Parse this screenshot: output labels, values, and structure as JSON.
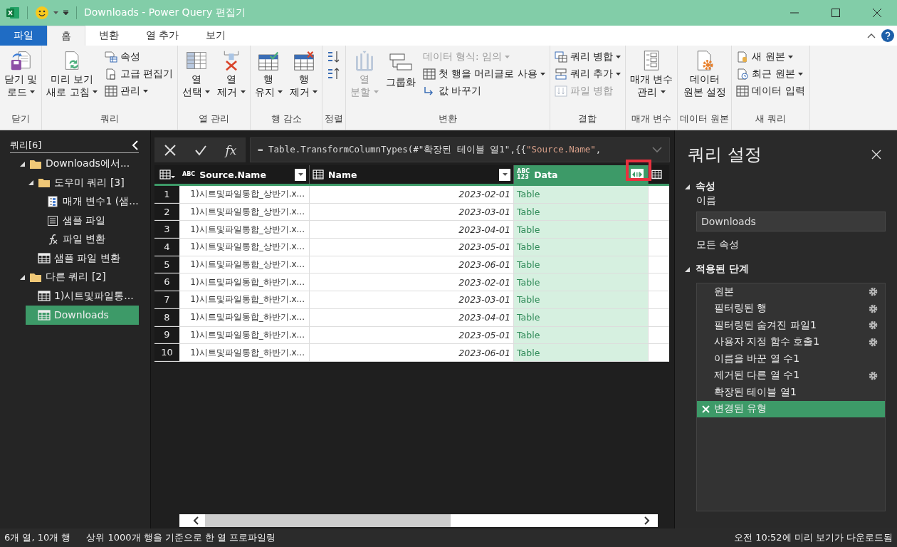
{
  "window": {
    "title": "Downloads - Power Query 편집기"
  },
  "ribbon_tabs": [
    {
      "label": "파일",
      "kind": "file",
      "selected": false
    },
    {
      "label": "홈",
      "kind": "tab",
      "selected": true
    },
    {
      "label": "변환",
      "kind": "tab",
      "selected": false
    },
    {
      "label": "열 추가",
      "kind": "tab",
      "selected": false
    },
    {
      "label": "보기",
      "kind": "tab",
      "selected": false
    }
  ],
  "ribbon_groups": [
    {
      "label": "닫기",
      "items": [
        {
          "kind": "large",
          "lines": [
            "닫기 및",
            "로드"
          ],
          "dropdown": true,
          "disabled": false
        }
      ]
    },
    {
      "label": "쿼리",
      "items": [
        {
          "kind": "large",
          "lines": [
            "미리 보기",
            "새로 고침"
          ],
          "dropdown": true,
          "disabled": false
        },
        {
          "kind": "small",
          "label": "속성",
          "dropdown": false,
          "disabled": false
        },
        {
          "kind": "small",
          "label": "고급 편집기",
          "dropdown": false,
          "disabled": false
        },
        {
          "kind": "small",
          "label": "관리",
          "dropdown": true,
          "disabled": false
        }
      ]
    },
    {
      "label": "열 관리",
      "items": [
        {
          "kind": "large",
          "lines": [
            "열",
            "선택"
          ],
          "dropdown": true,
          "disabled": false
        },
        {
          "kind": "large",
          "lines": [
            "열",
            "제거"
          ],
          "dropdown": true,
          "disabled": false
        }
      ]
    },
    {
      "label": "행 감소",
      "items": [
        {
          "kind": "large",
          "lines": [
            "행",
            "유지"
          ],
          "dropdown": true,
          "disabled": false
        },
        {
          "kind": "large",
          "lines": [
            "행",
            "제거"
          ],
          "dropdown": true,
          "disabled": false
        }
      ]
    },
    {
      "label": "정렬",
      "items": [
        {
          "kind": "icon"
        },
        {
          "kind": "icon"
        }
      ]
    },
    {
      "label": "변환",
      "items": [
        {
          "kind": "large",
          "lines": [
            "열",
            "분할"
          ],
          "dropdown": true,
          "disabled": true
        },
        {
          "kind": "large",
          "lines": [
            "그룹화"
          ],
          "dropdown": false,
          "disabled": false
        },
        {
          "kind": "small",
          "label": "데이터 형식: 임의",
          "dropdown": true,
          "disabled": true
        },
        {
          "kind": "small",
          "label": "첫 행을 머리글로 사용",
          "dropdown": true,
          "disabled": false
        },
        {
          "kind": "small",
          "label": "값 바꾸기",
          "dropdown": false,
          "disabled": false
        }
      ]
    },
    {
      "label": "결합",
      "items": [
        {
          "kind": "small",
          "label": "쿼리 병합",
          "dropdown": true,
          "disabled": false
        },
        {
          "kind": "small",
          "label": "쿼리 추가",
          "dropdown": true,
          "disabled": false
        },
        {
          "kind": "small",
          "label": "파일 병합",
          "dropdown": false,
          "disabled": true
        }
      ]
    },
    {
      "label": "매개 변수",
      "items": [
        {
          "kind": "large",
          "lines": [
            "매개 변수",
            "관리"
          ],
          "dropdown": true,
          "disabled": false
        }
      ]
    },
    {
      "label": "데이터 원본",
      "items": [
        {
          "kind": "large",
          "lines": [
            "데이터",
            "원본 설정"
          ],
          "dropdown": false,
          "disabled": false
        }
      ]
    },
    {
      "label": "새 쿼리",
      "items": [
        {
          "kind": "small",
          "label": "새 원본",
          "dropdown": true,
          "disabled": false
        },
        {
          "kind": "small",
          "label": "최근 원본",
          "dropdown": true,
          "disabled": false
        },
        {
          "kind": "small",
          "label": "데이터 입력",
          "dropdown": false,
          "disabled": false
        }
      ]
    }
  ],
  "queries_pane": {
    "title": "쿼리[6]",
    "items": [
      {
        "label": "Downloads에서...",
        "kind": "folder",
        "expanded": true,
        "selected": false,
        "children": [
          {
            "label": "도우미 쿼리 [3]",
            "kind": "folder",
            "expanded": true,
            "selected": false,
            "children": [
              {
                "label": "매개 변수1 (샘...",
                "kind": "parameter",
                "selected": false
              },
              {
                "label": "샘플 파일",
                "kind": "file",
                "selected": false
              },
              {
                "label": "파일 변환",
                "kind": "function",
                "selected": false
              }
            ]
          },
          {
            "label": "샘플 파일 변환",
            "kind": "table",
            "selected": false
          }
        ]
      },
      {
        "label": "다른 쿼리 [2]",
        "kind": "folder",
        "expanded": true,
        "selected": false,
        "children": [
          {
            "label": "1)시트및파일통...",
            "kind": "table",
            "selected": false
          },
          {
            "label": "Downloads",
            "kind": "table",
            "selected": true
          }
        ]
      }
    ]
  },
  "formula_bar": {
    "function_label": "fx",
    "segments": [
      {
        "text": "= Table.TransformColumnTypes(#\"확장된 테이블 열1\",{{",
        "kind": "code"
      },
      {
        "text": "\"Source.Name\"",
        "kind": "string"
      },
      {
        "text": ",",
        "kind": "code"
      }
    ]
  },
  "table": {
    "columns": [
      {
        "kind": "text",
        "type_label": "ABC",
        "name": "Source.Name",
        "filter": true,
        "selected": false,
        "expandable": false,
        "highlighted": false
      },
      {
        "kind": "table",
        "name": "Name",
        "filter": true,
        "selected": false,
        "expandable": false,
        "highlighted": false
      },
      {
        "kind": "any",
        "type_lines": [
          "ABC",
          "123"
        ],
        "name": "Data",
        "filter": false,
        "selected": true,
        "expandable": true,
        "highlighted": true
      },
      {
        "kind": "table",
        "filter": false,
        "selected": false,
        "expandable": false,
        "highlighted": false
      }
    ],
    "rows": [
      {
        "number": "1",
        "cells": [
          "1)시트및파일통합_상반기.x...",
          "2023-02-01",
          "Table"
        ]
      },
      {
        "number": "2",
        "cells": [
          "1)시트및파일통합_상반기.x...",
          "2023-03-01",
          "Table"
        ]
      },
      {
        "number": "3",
        "cells": [
          "1)시트및파일통합_상반기.x...",
          "2023-04-01",
          "Table"
        ]
      },
      {
        "number": "4",
        "cells": [
          "1)시트및파일통합_상반기.x...",
          "2023-05-01",
          "Table"
        ]
      },
      {
        "number": "5",
        "cells": [
          "1)시트및파일통합_상반기.x...",
          "2023-06-01",
          "Table"
        ]
      },
      {
        "number": "6",
        "cells": [
          "1)시트및파일통합_하반기.x...",
          "2023-02-01",
          "Table"
        ]
      },
      {
        "number": "7",
        "cells": [
          "1)시트및파일통합_하반기.x...",
          "2023-03-01",
          "Table"
        ]
      },
      {
        "number": "8",
        "cells": [
          "1)시트및파일통합_하반기.x...",
          "2023-04-01",
          "Table"
        ]
      },
      {
        "number": "9",
        "cells": [
          "1)시트및파일통합_하반기.x...",
          "2023-05-01",
          "Table"
        ]
      },
      {
        "number": "10",
        "cells": [
          "1)시트및파일통합_하반기.x...",
          "2023-06-01",
          "Table"
        ]
      }
    ]
  },
  "settings_pane": {
    "title": "쿼리 설정",
    "properties": {
      "heading": "속성",
      "expanded": true,
      "name_label": "이름",
      "name_value": "Downloads",
      "all_properties_link": "모든 속성"
    },
    "steps": {
      "heading": "적용된 단계",
      "expanded": true,
      "items": [
        {
          "label": "원본",
          "settings": true,
          "selected": false
        },
        {
          "label": "필터링된 행",
          "settings": true,
          "selected": false
        },
        {
          "label": "필터링된 숨겨진 파일1",
          "settings": true,
          "selected": false
        },
        {
          "label": "사용자 지정 함수 호출1",
          "settings": true,
          "selected": false
        },
        {
          "label": "이름을 바꾼 열 수1",
          "settings": false,
          "selected": false
        },
        {
          "label": "제거된 다른 열 수1",
          "settings": true,
          "selected": false
        },
        {
          "label": "확장된 테이블 열1",
          "settings": false,
          "selected": false
        },
        {
          "label": "변경된 유형",
          "settings": false,
          "selected": true
        }
      ]
    }
  },
  "status_bar": {
    "left": [
      "6개 열, 10개 행",
      "상위 1000개 행을 기준으로 한 열 프로파일링"
    ],
    "right": "오전 10:52에 미리 보기가 다운로드됨"
  }
}
